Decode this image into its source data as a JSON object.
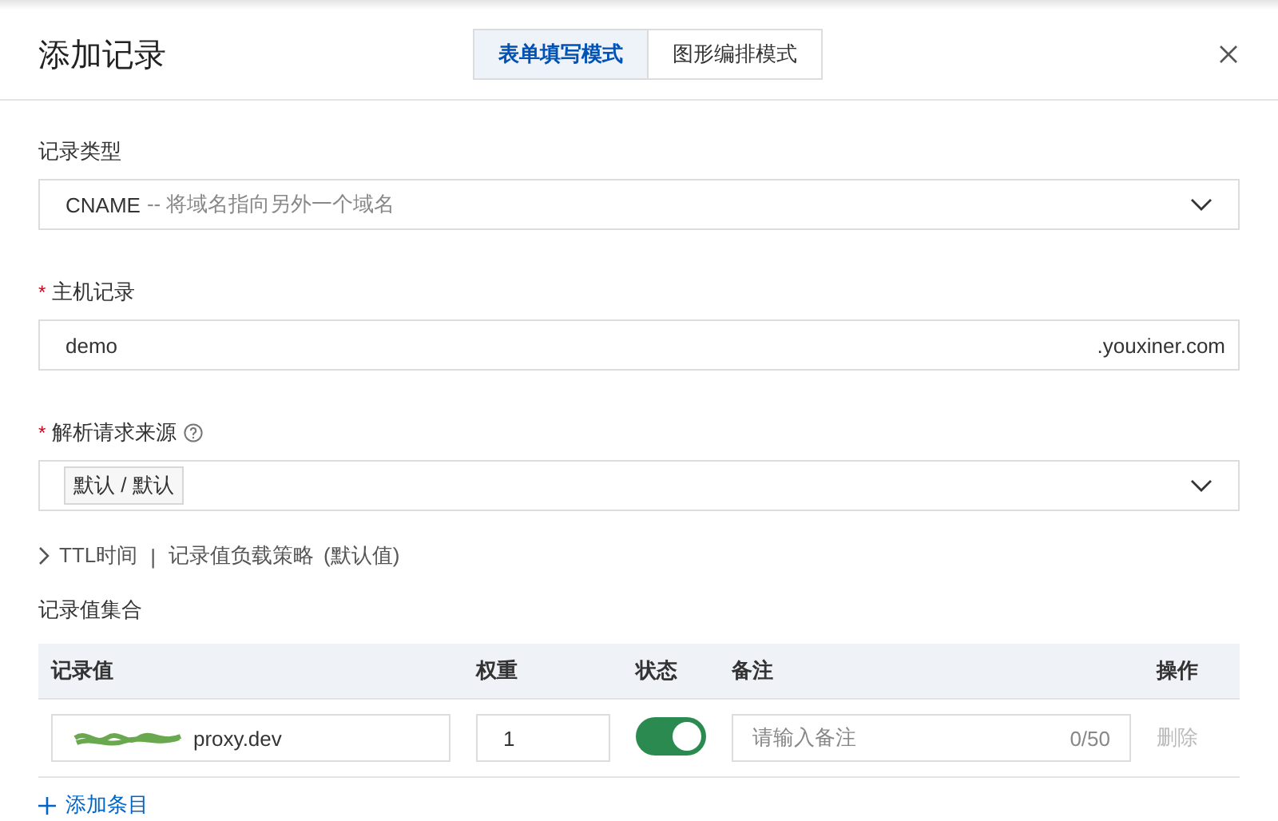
{
  "dialog": {
    "title": "添加记录",
    "mode_tabs": [
      {
        "label": "表单填写模式",
        "selected": true
      },
      {
        "label": "图形编排模式",
        "selected": false
      }
    ],
    "fields": [
      {
        "kind": "select",
        "label": "记录类型",
        "value": "CNAME",
        "hint": "-- 将域名指向另外一个域名"
      },
      {
        "kind": "input",
        "label": "主机记录",
        "required_mark": "*",
        "value": "demo",
        "suffix": ".youxiner.com"
      },
      {
        "kind": "tags",
        "label": "解析请求来源",
        "required_mark": "*",
        "help": true,
        "tags": [
          "默认 / 默认"
        ]
      }
    ],
    "advanced": {
      "expanded": false,
      "label": "TTL时间",
      "separator": "|",
      "label2": "记录值负载策略",
      "note": "(默认值)"
    },
    "records": {
      "title": "记录值集合",
      "columns": [
        "记录值",
        "权重",
        "状态",
        "备注",
        "操作"
      ],
      "rows": [
        {
          "value": "proxy.dev",
          "weight": "1",
          "enabled": true,
          "remark_placeholder": "请输入备注",
          "remark_count": "0/50",
          "action": "删除",
          "action_disabled": true
        }
      ],
      "add_label": "添加条目"
    }
  }
}
